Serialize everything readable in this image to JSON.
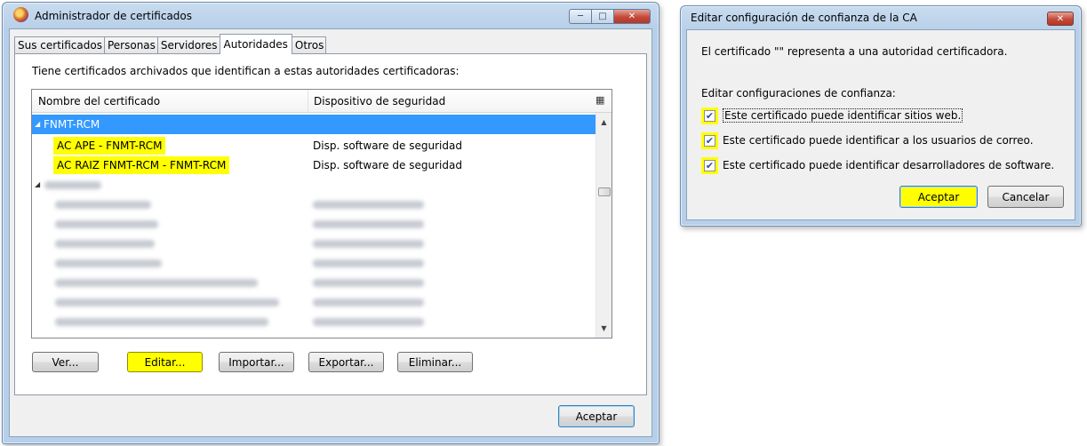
{
  "main_window": {
    "title": "Administrador de certificados",
    "tabs": [
      "Sus certificados",
      "Personas",
      "Servidores",
      "Autoridades",
      "Otros"
    ],
    "active_tab": "Autoridades",
    "intro": "Tiene certificados archivados que identifican a estas autoridades certificadoras:",
    "columns": {
      "name": "Nombre del certificado",
      "device": "Dispositivo de seguridad"
    },
    "group": "FNMT-RCM",
    "rows": [
      {
        "name": "AC APE - FNMT-RCM",
        "device": "Disp. software de seguridad"
      },
      {
        "name": "AC RAIZ FNMT-RCM - FNMT-RCM",
        "device": "Disp. software de seguridad"
      }
    ],
    "buttons": {
      "view": "Ver...",
      "edit": "Editar...",
      "import": "Importar...",
      "export": "Exportar...",
      "delete": "Eliminar...",
      "accept": "Aceptar"
    },
    "highlight_color": "#ffff00",
    "selection_color": "#3399ff"
  },
  "trust_dialog": {
    "title": "Editar configuración de confianza de la CA",
    "description": "El certificado \"\" representa a una autoridad certificadora.",
    "section_label": "Editar configuraciones de confianza:",
    "options": [
      {
        "label": "Este certificado puede identificar sitios web.",
        "checked": true
      },
      {
        "label": "Este certificado puede identificar a los usuarios de correo.",
        "checked": true
      },
      {
        "label": "Este certificado puede identificar desarrolladores de software.",
        "checked": true
      }
    ],
    "buttons": {
      "accept": "Aceptar",
      "cancel": "Cancelar"
    }
  }
}
